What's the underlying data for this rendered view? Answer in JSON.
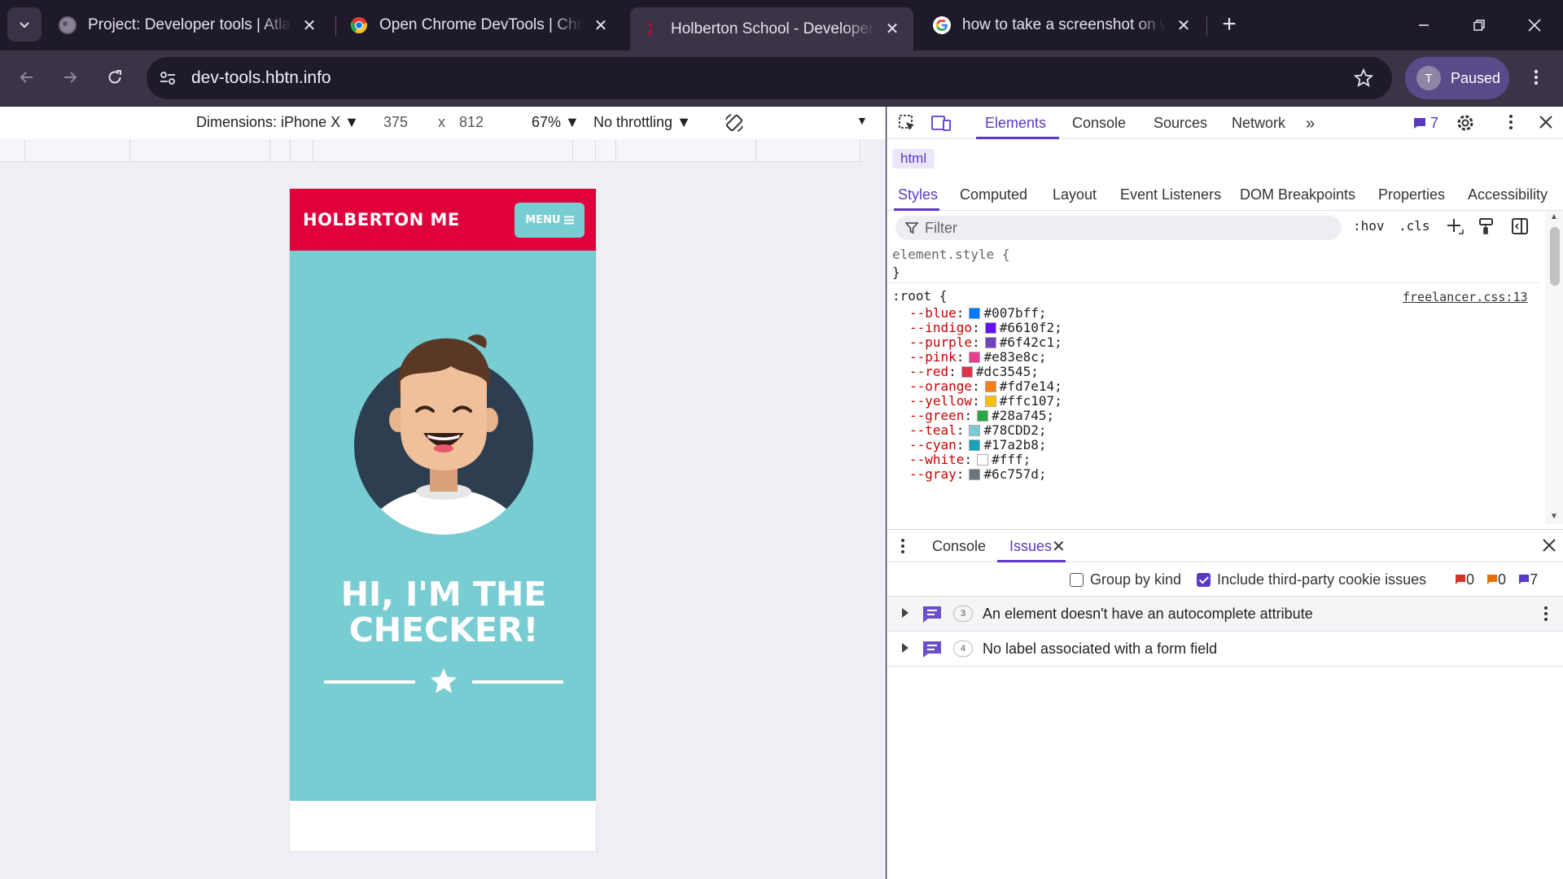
{
  "browser": {
    "tabs": [
      {
        "title": "Project: Developer tools | Atlas",
        "active": false
      },
      {
        "title": "Open Chrome DevTools  |  Chrome",
        "active": false
      },
      {
        "title": "Holberton School - Developer tools",
        "active": true
      },
      {
        "title": "how to take a screenshot on windows",
        "active": false
      }
    ],
    "url": "dev-tools.hbtn.info",
    "profile": {
      "initial": "T",
      "status": "Paused"
    }
  },
  "device_toolbar": {
    "dimensions": "Dimensions: iPhone X",
    "width": "375",
    "times": "x",
    "height": "812",
    "zoom": "67%",
    "throttling": "No throttling"
  },
  "site": {
    "brand": "HOLBERTON ME",
    "menu_label": "MENU",
    "hero_line1": "HI, I'M THE",
    "hero_line2": "CHECKER!",
    "colors": {
      "nav": "#e0003b",
      "masthead": "#78CDD2"
    }
  },
  "devtools": {
    "top_tabs": [
      "Elements",
      "Console",
      "Sources",
      "Network"
    ],
    "issues_count": "7",
    "breadcrumb": "html",
    "style_tabs": [
      "Styles",
      "Computed",
      "Layout",
      "Event Listeners",
      "DOM Breakpoints",
      "Properties",
      "Accessibility"
    ],
    "filter_placeholder": "Filter",
    "hov": ":hov",
    "cls": ".cls",
    "element_style_open": "element.style {",
    "close_brace": "}",
    "root_selector": ":root {",
    "source_link": "freelancer.css:13",
    "css_vars": [
      {
        "name": "--blue",
        "value": "#007bff"
      },
      {
        "name": "--indigo",
        "value": "#6610f2"
      },
      {
        "name": "--purple",
        "value": "#6f42c1"
      },
      {
        "name": "--pink",
        "value": "#e83e8c"
      },
      {
        "name": "--red",
        "value": "#dc3545"
      },
      {
        "name": "--orange",
        "value": "#fd7e14"
      },
      {
        "name": "--yellow",
        "value": "#ffc107"
      },
      {
        "name": "--green",
        "value": "#28a745"
      },
      {
        "name": "--teal",
        "value": "#78CDD2"
      },
      {
        "name": "--cyan",
        "value": "#17a2b8"
      },
      {
        "name": "--white",
        "value": "#fff"
      },
      {
        "name": "--gray",
        "value": "#6c757d"
      }
    ],
    "drawer": {
      "tabs": [
        "Console",
        "Issues"
      ],
      "group_by_kind": "Group by kind",
      "include_third_party": "Include third-party cookie issues",
      "counts": {
        "errors": "0",
        "warnings": "0",
        "info": "7"
      },
      "issues": [
        {
          "count": "3",
          "text": "An element doesn't have an autocomplete attribute"
        },
        {
          "count": "4",
          "text": "No label associated with a form field"
        }
      ]
    }
  }
}
